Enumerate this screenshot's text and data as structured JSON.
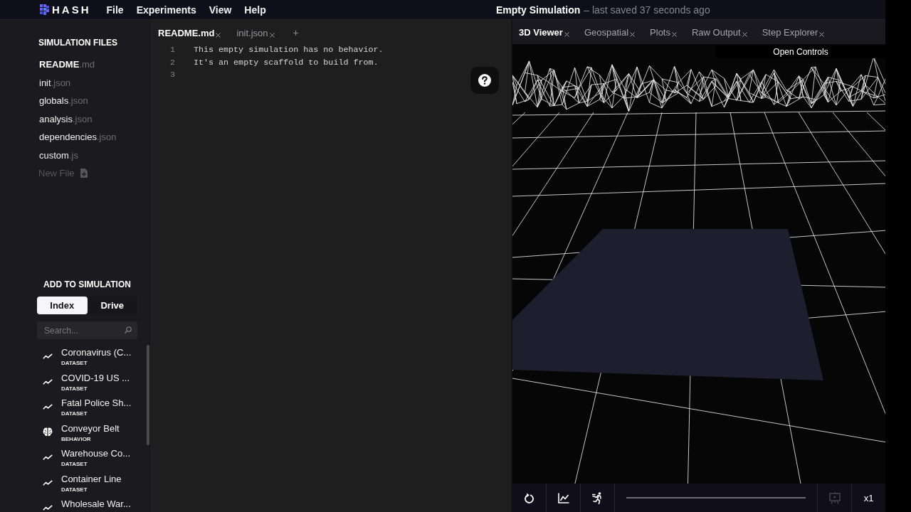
{
  "menu_bar": {
    "logo": "HASH",
    "menus": [
      "File",
      "Experiments",
      "View",
      "Help"
    ],
    "title": "Empty Simulation",
    "save_status": "– last saved 37 seconds ago"
  },
  "sidebar": {
    "files_heading": "SIMULATION FILES",
    "files": [
      {
        "name": "README",
        "extension": ".md",
        "selected": true
      },
      {
        "name": "init",
        "extension": ".json",
        "selected": false
      },
      {
        "name": "globals",
        "extension": ".json",
        "selected": false
      },
      {
        "name": "analysis",
        "extension": ".json",
        "selected": false
      },
      {
        "name": "dependencies",
        "extension": ".json",
        "selected": false
      },
      {
        "name": "custom",
        "extension": ".js",
        "selected": false
      }
    ],
    "new_file": {
      "label": "New File",
      "disabled": true
    },
    "add_heading": "ADD TO SIMULATION",
    "tabs": [
      {
        "label": "Index",
        "selected": true
      },
      {
        "label": "Drive",
        "selected": false
      }
    ],
    "search": {
      "placeholder": "Search..."
    },
    "items": [
      {
        "name": "Coronavirus (C...",
        "type": "DATASET",
        "kind": "dataset"
      },
      {
        "name": "COVID-19 US ...",
        "type": "DATASET",
        "kind": "dataset"
      },
      {
        "name": "Fatal Police Sh...",
        "type": "DATASET",
        "kind": "dataset"
      },
      {
        "name": "Conveyor Belt",
        "type": "BEHAVIOR",
        "kind": "behavior"
      },
      {
        "name": "Warehouse Co...",
        "type": "DATASET",
        "kind": "dataset"
      },
      {
        "name": "Container Line",
        "type": "DATASET",
        "kind": "dataset"
      },
      {
        "name": "Wholesale War...",
        "kind": "dataset"
      }
    ]
  },
  "editor": {
    "tabs": [
      {
        "label": "README.md",
        "selected": true
      },
      {
        "label": "init.json",
        "selected": false
      }
    ],
    "add_tab": "+",
    "lines": [
      {
        "number": "1",
        "text": "This empty simulation has no behavior."
      },
      {
        "number": "2",
        "text": "It's an empty scaffold to build from."
      },
      {
        "number": "3"
      }
    ]
  },
  "viewer": {
    "tabs": [
      {
        "label": "3D Viewer",
        "selected": true
      },
      {
        "label": "Geospatial",
        "selected": false
      },
      {
        "label": "Plots",
        "selected": false
      },
      {
        "label": "Raw Output",
        "selected": false
      },
      {
        "label": "Step Explorer",
        "selected": false
      }
    ],
    "open_controls": "Open Controls",
    "toolbar": {
      "tools": [
        {
          "kind": "reset",
          "disabled": false
        },
        {
          "kind": "plots",
          "disabled": false
        },
        {
          "kind": "run",
          "disabled": false
        }
      ],
      "right_tools": [
        {
          "kind": "present",
          "disabled": true
        }
      ],
      "speed": "x1"
    }
  }
}
